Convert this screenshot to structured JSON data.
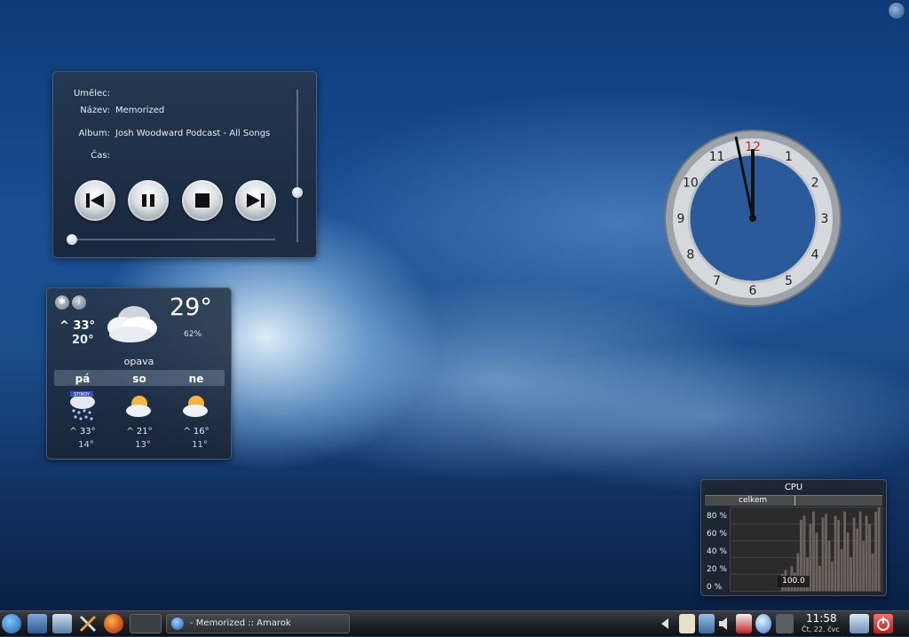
{
  "desktop": {
    "corner_button_icon": "cashew-icon"
  },
  "media_player": {
    "artist_label": "Umělec:",
    "artist_value": "",
    "title_label": "Název:",
    "title_value": "Memorized",
    "album_label": "Album:",
    "album_value": "Josh Woodward Podcast - All Songs",
    "time_label": "Čas:",
    "time_value": "",
    "buttons": [
      "previous",
      "pause",
      "stop",
      "next"
    ],
    "volume_level": 0.35,
    "position_level": 0.0
  },
  "weather": {
    "current_hi": "^ 33°",
    "current_lo": "20°",
    "current_temp": "29°",
    "humidity": "62%",
    "city": "opava",
    "forecast": [
      {
        "day": "pá",
        "hi": "^ 33°",
        "lo": "14°",
        "icon": "rain-icon",
        "badge": "STINDY"
      },
      {
        "day": "so",
        "hi": "^ 21°",
        "lo": "13°",
        "icon": "partly-cloudy-icon"
      },
      {
        "day": "ne",
        "hi": "^ 16°",
        "lo": "11°",
        "icon": "partly-cloudy-icon"
      }
    ]
  },
  "clock": {
    "numerals": [
      "12",
      "1",
      "2",
      "3",
      "4",
      "5",
      "6",
      "7",
      "8",
      "9",
      "10",
      "11"
    ],
    "time": "11:58"
  },
  "cpu_monitor": {
    "title": "CPU",
    "legend": "celkem",
    "y_labels": [
      "80 %",
      "60 %",
      "40 %",
      "20 %",
      "0 %"
    ],
    "current_value": "100.0"
  },
  "taskbar": {
    "task_title": "- Memorized   ::   Amarok",
    "time": "11:58",
    "date": "Čt, 22. čvc"
  },
  "chart_data": {
    "type": "bar",
    "title": "CPU",
    "series": [
      {
        "name": "celkem",
        "values": [
          0,
          0,
          0,
          0,
          0,
          0,
          0,
          0,
          0,
          0,
          0,
          0,
          0,
          0,
          0,
          0,
          20,
          25,
          15,
          30,
          22,
          45,
          85,
          90,
          40,
          80,
          95,
          70,
          30,
          88,
          92,
          60,
          35,
          90,
          85,
          50,
          95,
          70,
          40,
          88,
          75,
          95,
          60,
          90,
          80,
          45,
          95,
          100
        ]
      }
    ],
    "ylim": [
      0,
      100
    ]
  }
}
